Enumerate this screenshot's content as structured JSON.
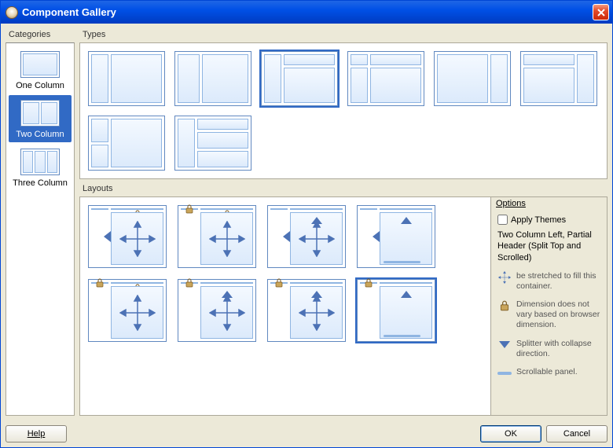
{
  "window": {
    "title": "Component Gallery"
  },
  "categories": {
    "header": "Categories",
    "items": [
      {
        "label": "One Column",
        "cols": 1
      },
      {
        "label": "Two Column",
        "cols": 2
      },
      {
        "label": "Three Column",
        "cols": 3
      }
    ],
    "selected": 1
  },
  "types": {
    "header": "Types",
    "selected": 2
  },
  "layouts": {
    "header": "Layouts",
    "selected": 7
  },
  "options": {
    "header": "Options",
    "apply_themes_label": "Apply Themes",
    "desc": "Two Column Left, Partial Header (Split Top and Scrolled)",
    "legend": {
      "stretch": "be stretched to fill this container.",
      "lock": "Dimension does not vary based on browser dimension.",
      "splitter": "Splitter with collapse direction.",
      "scroll": "Scrollable panel."
    }
  },
  "footer": {
    "help_label": "Help",
    "ok_label": "OK",
    "cancel_label": "Cancel"
  }
}
